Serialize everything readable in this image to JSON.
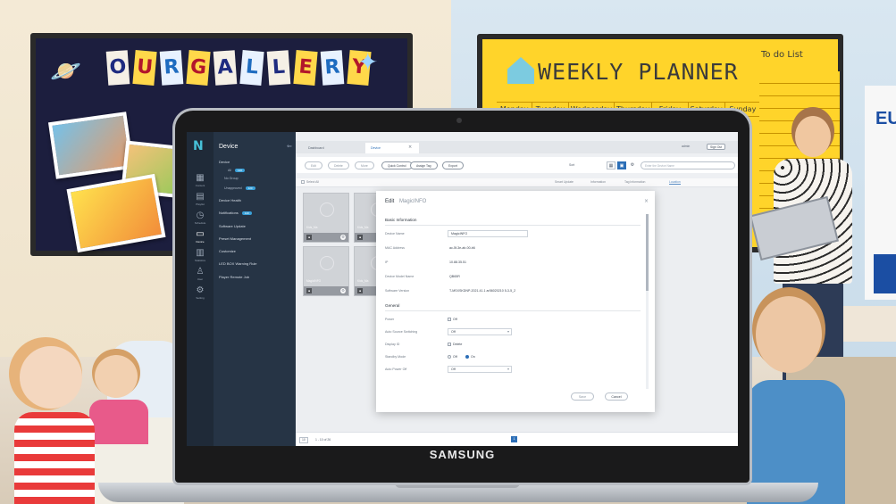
{
  "background": {
    "gallery_letters": [
      "O",
      "U",
      "R",
      "G",
      "A",
      "L",
      "L",
      "E",
      "R",
      "Y"
    ],
    "planner_title": "WEEKLY PLANNER",
    "planner_todo": "To do List",
    "planner_days": [
      "Monday",
      "Tuesday",
      "Wednesday",
      "Thursday",
      "Friday",
      "Saturday",
      "Sunday"
    ],
    "wall_sign": "EU",
    "laptop_brand": "SAMSUNG"
  },
  "app": {
    "logo_icon": "n-logo-icon",
    "rail": [
      {
        "icon": "content-icon",
        "label": "Content"
      },
      {
        "icon": "playlist-icon",
        "label": "Playlist"
      },
      {
        "icon": "schedule-icon",
        "label": "Schedule"
      },
      {
        "icon": "device-icon",
        "label": "Device"
      },
      {
        "icon": "statistics-icon",
        "label": "Statistics"
      },
      {
        "icon": "user-icon",
        "label": "User"
      },
      {
        "icon": "settings-icon",
        "label": "Setting"
      }
    ],
    "nav": {
      "title": "Device",
      "items": [
        {
          "label": "Device",
          "level": 1
        },
        {
          "label": "All",
          "level": 2,
          "badge": "120"
        },
        {
          "label": "No Group",
          "level": 2
        },
        {
          "label": "Unapproved",
          "level": 2,
          "badge": "120"
        },
        {
          "label": "Device Health",
          "level": 1
        },
        {
          "label": "Notifications",
          "level": 1,
          "badge": "120"
        },
        {
          "label": "Software Update",
          "level": 1
        },
        {
          "label": "Preset Management",
          "level": 1
        },
        {
          "label": "Customize",
          "level": 1
        },
        {
          "label": "LED BOX Warning Rule",
          "level": 1
        },
        {
          "label": "Player Remote Job",
          "level": 1
        }
      ]
    },
    "tabs": [
      {
        "label": "Dashboard",
        "active": false
      },
      {
        "label": "Device",
        "active": true
      }
    ],
    "user": "admin",
    "logout_label": "Sign Out",
    "toolbar": {
      "buttons": [
        {
          "label": "Edit",
          "enabled": false
        },
        {
          "label": "Delete",
          "enabled": false
        },
        {
          "label": "More",
          "enabled": false
        },
        {
          "label": "Quick Control",
          "enabled": true
        },
        {
          "label": "Assign Tag",
          "enabled": true
        },
        {
          "label": "Export",
          "enabled": true
        }
      ],
      "sort_label": "Sort",
      "search_placeholder": "Enter the Device Name"
    },
    "filter": {
      "select_all": "Select All",
      "tabs": [
        "Smart Update",
        "Information",
        "Tag Information",
        "Location"
      ]
    },
    "tiles": [
      {
        "name": "Kids_Ma",
        "col": 0,
        "row": 0
      },
      {
        "name": "Kids_Ma",
        "col": 1,
        "row": 0
      },
      {
        "name": "MagicINFO",
        "col": 0,
        "row": 1
      },
      {
        "name": "Kids_Ma",
        "col": 1,
        "row": 1
      },
      {
        "name": "Kids_Ma",
        "col": 5,
        "row": 0
      }
    ],
    "pager": {
      "page_size": "10",
      "summary": "1 - 10 of 26",
      "current_page": "1"
    },
    "dialog": {
      "title": "Edit",
      "device_name": "MagicINFO",
      "basic_section": "Basic Information",
      "fields": [
        {
          "label": "Device Name",
          "value": "MagicINFO",
          "kind": "input"
        },
        {
          "label": "MAC Address",
          "value": "ac-5f-3e-ab-00-b6",
          "kind": "text"
        },
        {
          "label": "IP",
          "value": "10.88.35.51",
          "kind": "text"
        },
        {
          "label": "Device Model Name",
          "value": "QB65R",
          "kind": "text"
        },
        {
          "label": "Software Version",
          "value": "T-MSXSKDNP-2021.41.1 ar56020210 5-3-5_2",
          "kind": "text"
        }
      ],
      "general_section": "General",
      "general_fields": [
        {
          "label": "Power",
          "value": "Off",
          "kind": "check"
        },
        {
          "label": "Auto Source Switching",
          "value": "Off",
          "kind": "select"
        },
        {
          "label": "Display ID",
          "value": "Delete",
          "kind": "check"
        },
        {
          "label": "Standby Mode",
          "options": [
            "Off",
            "On"
          ],
          "selected": "On",
          "kind": "radio"
        },
        {
          "label": "Auto Power Off",
          "value": "Off",
          "kind": "select"
        }
      ],
      "save_label": "Save",
      "cancel_label": "Cancel"
    }
  }
}
